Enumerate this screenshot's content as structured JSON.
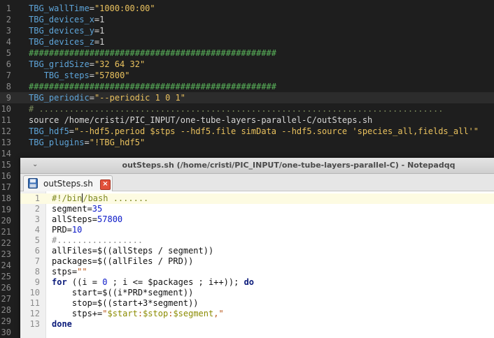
{
  "background_editor": {
    "lines": [
      {
        "num": "1",
        "parts": [
          [
            "var",
            "TBG_wallTime"
          ],
          [
            "plain",
            "="
          ],
          [
            "str",
            "\"1000:00:00\""
          ]
        ]
      },
      {
        "num": "2",
        "parts": [
          [
            "var",
            "TBG_devices_x"
          ],
          [
            "plain",
            "=1"
          ]
        ]
      },
      {
        "num": "3",
        "parts": [
          [
            "var",
            "TBG_devices_y"
          ],
          [
            "plain",
            "=1"
          ]
        ]
      },
      {
        "num": "4",
        "parts": [
          [
            "var",
            "TBG_devices_z"
          ],
          [
            "plain",
            "=1"
          ]
        ]
      },
      {
        "num": "5",
        "parts": [
          [
            "hash",
            "#################################################"
          ]
        ]
      },
      {
        "num": "6",
        "parts": [
          [
            "var",
            "TBG_gridSize"
          ],
          [
            "plain",
            "="
          ],
          [
            "str",
            "\"32 64 32\""
          ]
        ]
      },
      {
        "num": "7",
        "parts": [
          [
            "plain",
            "   "
          ],
          [
            "var",
            "TBG_steps"
          ],
          [
            "plain",
            "="
          ],
          [
            "str",
            "\"57800\""
          ]
        ]
      },
      {
        "num": "8",
        "parts": [
          [
            "hash",
            "#################################################"
          ]
        ]
      },
      {
        "num": "9",
        "parts": [
          [
            "var",
            "TBG_periodic"
          ],
          [
            "plain",
            "="
          ],
          [
            "str",
            "\"--periodic 1 0 1\""
          ]
        ]
      },
      {
        "num": "10",
        "parts": [
          [
            "cmt",
            "# ................................................................................"
          ]
        ]
      },
      {
        "num": "11",
        "parts": [
          [
            "plain",
            "source /home/cristi/PIC_INPUT/one-tube-layers-parallel-C/outSteps.sh"
          ]
        ]
      },
      {
        "num": "12",
        "parts": [
          [
            "var",
            "TBG_hdf5"
          ],
          [
            "plain",
            "="
          ],
          [
            "str",
            "\"--hdf5.period $stps --hdf5.file simData --hdf5.source 'species_all,fields_all'\""
          ]
        ]
      },
      {
        "num": "13",
        "parts": [
          [
            "var",
            "TBG_plugins"
          ],
          [
            "plain",
            "="
          ],
          [
            "str",
            "\"!TBG_hdf5\""
          ]
        ]
      },
      {
        "num": "14",
        "parts": []
      },
      {
        "num": "15",
        "parts": []
      },
      {
        "num": "16",
        "parts": []
      },
      {
        "num": "17",
        "parts": []
      },
      {
        "num": "18",
        "parts": []
      },
      {
        "num": "19",
        "parts": []
      },
      {
        "num": "20",
        "parts": []
      },
      {
        "num": "21",
        "parts": []
      },
      {
        "num": "22",
        "parts": []
      },
      {
        "num": "23",
        "parts": []
      },
      {
        "num": "24",
        "parts": []
      },
      {
        "num": "25",
        "parts": []
      },
      {
        "num": "26",
        "parts": []
      },
      {
        "num": "27",
        "parts": []
      },
      {
        "num": "28",
        "parts": []
      },
      {
        "num": "29",
        "parts": []
      },
      {
        "num": "30",
        "parts": []
      }
    ]
  },
  "window": {
    "title": "outSteps.sh (/home/cristi/PIC_INPUT/one-tube-layers-parallel-C) - Notepadqq",
    "menu_icon": "⌄",
    "tab": {
      "label": "outSteps.sh",
      "close_icon": "×"
    },
    "lines": [
      {
        "num": "1",
        "parts": [
          [
            "sheb",
            "#!/bin"
          ],
          [
            "cursor",
            ""
          ],
          [
            "sheb",
            "/bash ......."
          ]
        ]
      },
      {
        "num": "2",
        "parts": [
          [
            "plain",
            "segment="
          ],
          [
            "num",
            "35"
          ]
        ]
      },
      {
        "num": "3",
        "parts": [
          [
            "plain",
            "allSteps="
          ],
          [
            "num",
            "57800"
          ]
        ]
      },
      {
        "num": "4",
        "parts": [
          [
            "plain",
            "PRD="
          ],
          [
            "num",
            "10"
          ]
        ]
      },
      {
        "num": "5",
        "parts": [
          [
            "cmt",
            "#................."
          ]
        ]
      },
      {
        "num": "6",
        "parts": [
          [
            "plain",
            "allFiles=$((allSteps / segment))"
          ]
        ]
      },
      {
        "num": "7",
        "parts": [
          [
            "plain",
            "packages=$((allFiles / PRD))"
          ]
        ]
      },
      {
        "num": "8",
        "parts": [
          [
            "plain",
            "stps="
          ],
          [
            "str",
            "\"\""
          ]
        ]
      },
      {
        "num": "9",
        "parts": [
          [
            "kw",
            "for"
          ],
          [
            "plain",
            " ((i = "
          ],
          [
            "num",
            "0"
          ],
          [
            "plain",
            " ; i <= $packages ; i++)); "
          ],
          [
            "kw",
            "do"
          ]
        ]
      },
      {
        "num": "10",
        "parts": [
          [
            "plain",
            "    start=$((i*PRD*segment))"
          ]
        ]
      },
      {
        "num": "11",
        "parts": [
          [
            "plain",
            "    stop=$((start+3*segment))"
          ]
        ]
      },
      {
        "num": "12",
        "parts": [
          [
            "plain",
            "    stps+="
          ],
          [
            "str",
            "\""
          ],
          [
            "strv",
            "$start"
          ],
          [
            "str",
            ":"
          ],
          [
            "strv",
            "$stop"
          ],
          [
            "str",
            ":"
          ],
          [
            "strv",
            "$segment"
          ],
          [
            "str",
            ",\""
          ]
        ]
      },
      {
        "num": "13",
        "parts": [
          [
            "kw",
            "done"
          ]
        ]
      }
    ]
  },
  "colors": {
    "bg_var": "#5ea4d8",
    "bg_string": "#e9c15e",
    "bg_hash": "#59b35a",
    "fg_number": "#0a18c8",
    "fg_keyword": "#0a1a7a",
    "fg_string": "#b8561a",
    "tab_close": "#e2513a"
  }
}
